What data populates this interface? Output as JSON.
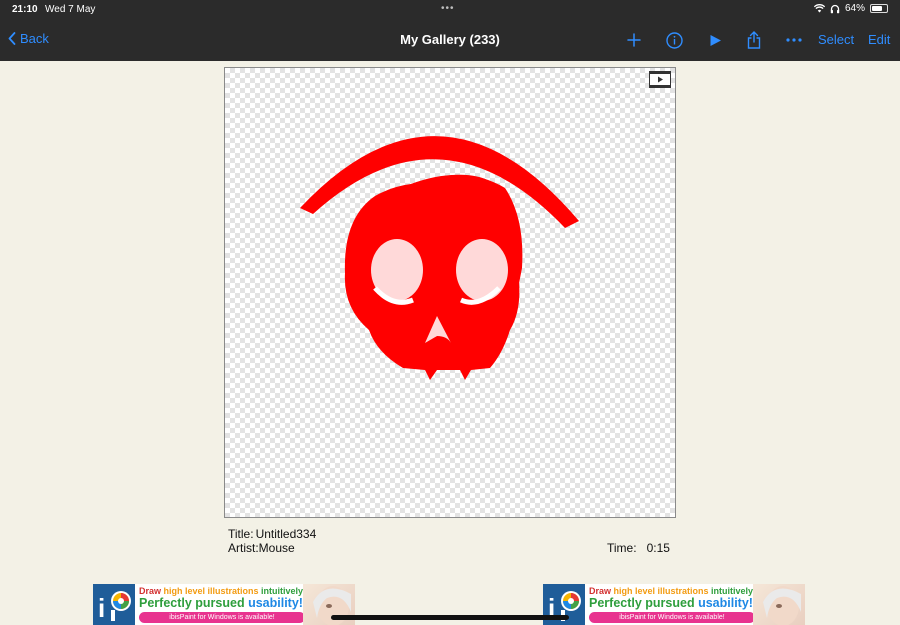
{
  "status": {
    "time": "21:10",
    "date": "Wed 7 May",
    "battery": "64%",
    "battery_level": 0.64
  },
  "nav": {
    "back": "Back",
    "title": "My Gallery (233)",
    "select": "Select",
    "edit": "Edit",
    "icons": [
      "add-icon",
      "info-icon",
      "play-icon",
      "share-icon",
      "more-icon"
    ]
  },
  "artwork": {
    "title_label": "Title:",
    "title": "Untitled334",
    "artist_label": "Artist:",
    "artist": "Mouse",
    "time_label": "Time:",
    "time": "0:15",
    "color": "#ff0000"
  },
  "ad": {
    "line1": {
      "a": "Draw ",
      "b": "high level illustrations",
      "c": " intuitively!"
    },
    "line2": {
      "a": "Perfectly pursued ",
      "b": "usability!"
    },
    "line3": "ibisPaint for Windows is available!"
  },
  "colors": {
    "accent": "#2f8dff",
    "bar": "#2b2b2b",
    "background": "#f3f1e6"
  }
}
